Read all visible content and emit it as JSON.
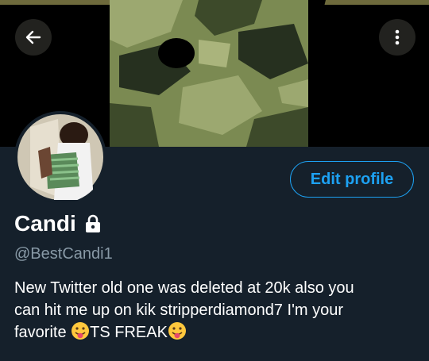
{
  "header": {
    "back_icon": "arrow-left-icon",
    "more_icon": "more-vertical-icon",
    "banner_colors": {
      "light": "#9ca870",
      "mid": "#72804a",
      "dark": "#3d4a2a",
      "darkest": "#26301f"
    }
  },
  "profile": {
    "edit_label": "Edit profile",
    "name": "Candi",
    "lock_icon": "lock-icon",
    "handle": "@BestCandi1",
    "bio_line1": "New Twitter old one was deleted at 20k also you",
    "bio_line2": "can hit me up on kik stripperdiamond7 I'm your",
    "bio_line3_a": "favorite ",
    "bio_line3_b": "TS FREAK",
    "emoji_icon": "tongue-out-face-emoji"
  },
  "colors": {
    "background": "#15202b",
    "accent": "#1da1f2",
    "secondary_text": "#8899a6"
  }
}
